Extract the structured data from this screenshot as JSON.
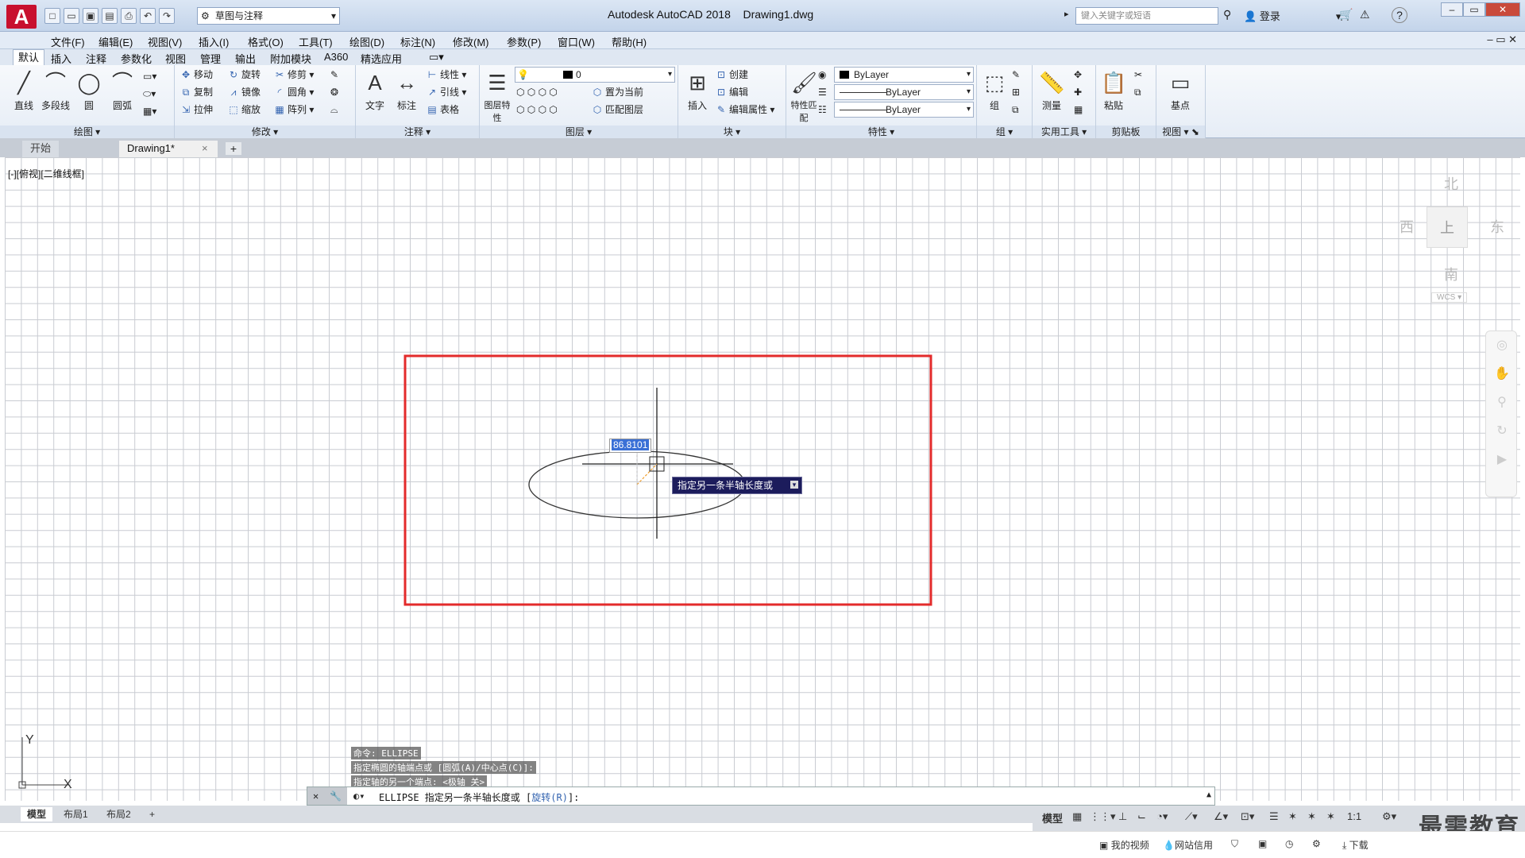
{
  "app": {
    "logo": "A",
    "title": "Autodesk AutoCAD 2018",
    "document": "Drawing1.dwg"
  },
  "qat": {
    "workspace": "草图与注释",
    "icons": [
      "new-icon",
      "open-icon",
      "save-icon",
      "saveas-icon",
      "plot-icon",
      "undo-icon",
      "redo-icon"
    ]
  },
  "search": {
    "placeholder": "键入关键字或短语"
  },
  "user": {
    "login": "登录"
  },
  "menus": [
    "文件(F)",
    "编辑(E)",
    "视图(V)",
    "插入(I)",
    "格式(O)",
    "工具(T)",
    "绘图(D)",
    "标注(N)",
    "修改(M)",
    "参数(P)",
    "窗口(W)",
    "帮助(H)"
  ],
  "ribbon_tabs": [
    "默认",
    "插入",
    "注释",
    "参数化",
    "视图",
    "管理",
    "输出",
    "附加模块",
    "A360",
    "精选应用"
  ],
  "panels": {
    "draw": {
      "title": "绘图",
      "big": [
        "直线",
        "多段线",
        "圆",
        "圆弧"
      ]
    },
    "modify": {
      "title": "修改",
      "items": [
        "移动",
        "旋转",
        "修剪",
        "复制",
        "镜像",
        "圆角",
        "拉伸",
        "缩放",
        "阵列"
      ]
    },
    "annotate": {
      "title": "注释",
      "big": [
        "文字",
        "标注"
      ],
      "items": [
        "线性",
        "引线",
        "表格"
      ]
    },
    "layers": {
      "title": "图层",
      "big": "图层特性",
      "current": "0",
      "items": [
        "置为当前",
        "匹配图层"
      ]
    },
    "block": {
      "title": "块",
      "big": "插入",
      "items": [
        "创建",
        "编辑",
        "编辑属性"
      ]
    },
    "properties": {
      "title": "特性",
      "big": "特性匹配",
      "color": "ByLayer",
      "linetype": "ByLayer",
      "lineweight": "ByLayer"
    },
    "groups": {
      "title": "组",
      "big": "组"
    },
    "utilities": {
      "title": "实用工具",
      "big": "测量"
    },
    "clipboard": {
      "title": "剪贴板",
      "big": "粘贴"
    },
    "view": {
      "title": "视图",
      "big": "基点"
    }
  },
  "file_tabs": {
    "start": "开始",
    "drawing": "Drawing1*",
    "new": "+"
  },
  "viewport": {
    "label": "[-][俯视][二维线框]",
    "viewcube": {
      "n": "北",
      "s": "南",
      "e": "东",
      "w": "西",
      "center": "上",
      "wcs": "WCS"
    },
    "dyn_input": "86.8101",
    "tooltip": "指定另一条半轴长度或",
    "ucs": {
      "x": "X",
      "y": "Y"
    }
  },
  "command": {
    "history": [
      "命令: ELLIPSE",
      "指定椭圆的轴端点或 [圆弧(A)/中心点(C)]:",
      "指定轴的另一个端点: <极轴 关>"
    ],
    "prompt_prefix": "ELLIPSE 指定另一条半轴长度或 [",
    "option": "旋转(R)",
    "prompt_suffix": "]:"
  },
  "layout_tabs": [
    "模型",
    "布局1",
    "布局2",
    "+"
  ],
  "status": {
    "model": "模型",
    "scale": "1:1"
  },
  "taskbar": {
    "video": "我的视频",
    "credit": "网站信用",
    "download": "下载"
  },
  "watermark": "最需教育",
  "colors": {
    "highlight": "#e32b2b",
    "tooltip_bg": "#1c1c5c",
    "input_bg": "#3a70d6"
  }
}
